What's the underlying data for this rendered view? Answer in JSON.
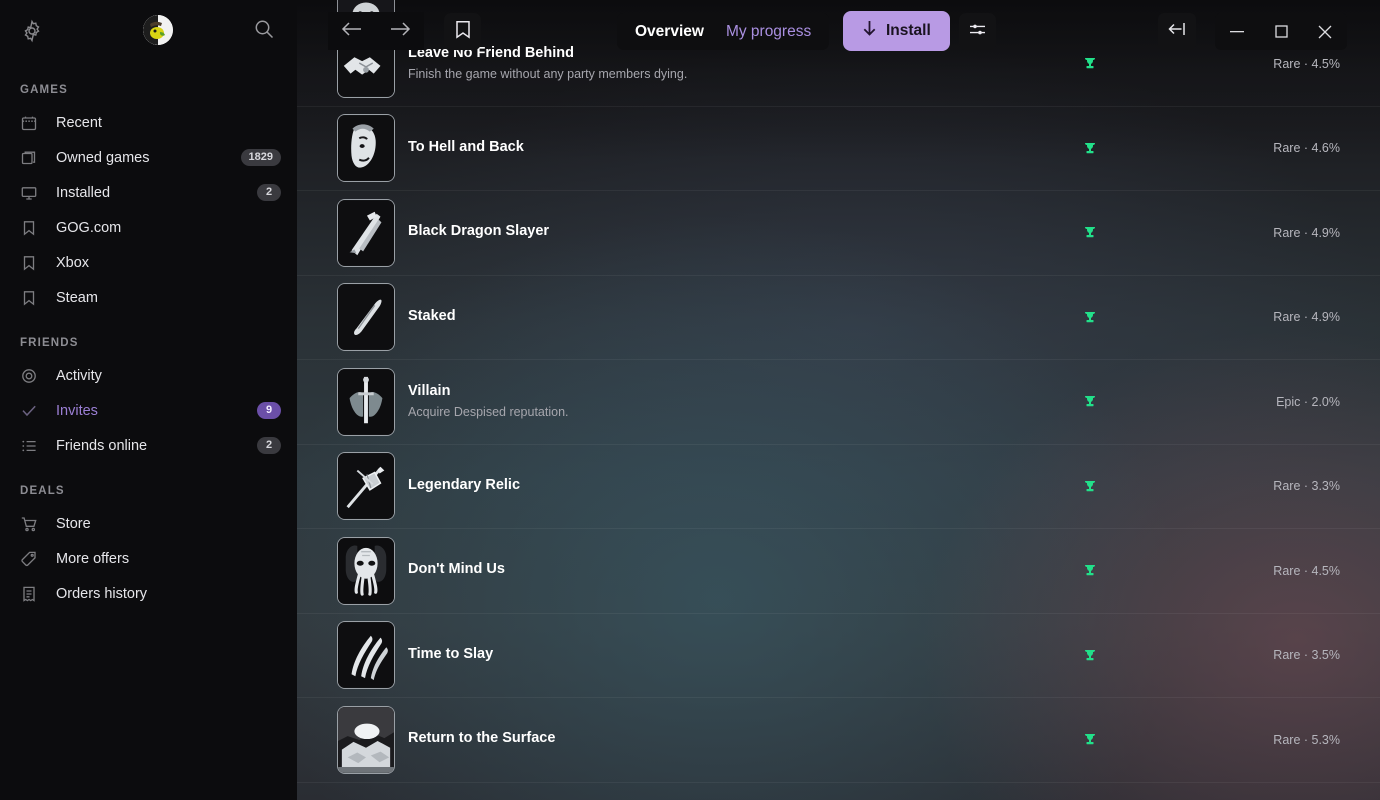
{
  "sidebar": {
    "top": {
      "settings_icon": "gear-icon",
      "avatar_icon": "user-avatar",
      "search_icon": "search-icon"
    },
    "sections": [
      {
        "title": "GAMES",
        "items": [
          {
            "label": "Recent",
            "icon": "calendar-icon",
            "badge": null,
            "accent": false
          },
          {
            "label": "Owned games",
            "icon": "stack-icon",
            "badge": "1829",
            "accent": false
          },
          {
            "label": "Installed",
            "icon": "monitor-icon",
            "badge": "2",
            "accent": false
          },
          {
            "label": "GOG.com",
            "icon": "bookmark-icon",
            "badge": null,
            "accent": false
          },
          {
            "label": "Xbox",
            "icon": "bookmark-icon",
            "badge": null,
            "accent": false
          },
          {
            "label": "Steam",
            "icon": "bookmark-icon",
            "badge": null,
            "accent": false
          }
        ]
      },
      {
        "title": "FRIENDS",
        "items": [
          {
            "label": "Activity",
            "icon": "target-icon",
            "badge": null,
            "accent": false
          },
          {
            "label": "Invites",
            "icon": "check-icon",
            "badge": "9",
            "accent": true,
            "badge_purple": true
          },
          {
            "label": "Friends online",
            "icon": "list-icon",
            "badge": "2",
            "accent": false
          }
        ]
      },
      {
        "title": "DEALS",
        "items": [
          {
            "label": "Store",
            "icon": "cart-icon",
            "badge": null,
            "accent": false
          },
          {
            "label": "More offers",
            "icon": "tag-icon",
            "badge": null,
            "accent": false
          },
          {
            "label": "Orders history",
            "icon": "receipt-icon",
            "badge": null,
            "accent": false
          }
        ]
      }
    ]
  },
  "toolbar": {
    "back_icon": "arrow-left-icon",
    "forward_icon": "arrow-right-icon",
    "bookmark_icon": "bookmark-icon",
    "tabs": [
      {
        "label": "Overview",
        "active": true
      },
      {
        "label": "My progress",
        "active": false
      }
    ],
    "install_label": "Install",
    "install_icon": "download-arrow-icon",
    "install_color": "#b89ae4",
    "filter_icon": "sliders-icon",
    "collapse_icon": "collapse-panel-icon",
    "minimize_icon": "minimize-icon",
    "maximize_icon": "maximize-icon",
    "close_icon": "close-icon"
  },
  "achievements": {
    "trophy_color": "#22e08a",
    "items": [
      {
        "name": "Leave No Friend Behind",
        "desc": "Finish the game without any party members dying.",
        "rarity": "Rare · 4.5%",
        "icon": "handshake-icon"
      },
      {
        "name": "To Hell and Back",
        "desc": "",
        "rarity": "Rare · 4.6%",
        "icon": "face-icon"
      },
      {
        "name": "Black Dragon Slayer",
        "desc": "",
        "rarity": "Rare · 4.9%",
        "icon": "dragon-claw-icon"
      },
      {
        "name": "Staked",
        "desc": "",
        "rarity": "Rare · 4.9%",
        "icon": "stake-icon"
      },
      {
        "name": "Villain",
        "desc": "Acquire Despised reputation.",
        "rarity": "Epic · 2.0%",
        "icon": "sword-icon"
      },
      {
        "name": "Legendary Relic",
        "desc": "",
        "rarity": "Rare · 3.3%",
        "icon": "relic-icon"
      },
      {
        "name": "Don't Mind Us",
        "desc": "",
        "rarity": "Rare · 4.5%",
        "icon": "mindflayer-icon"
      },
      {
        "name": "Time to Slay",
        "desc": "",
        "rarity": "Rare · 3.5%",
        "icon": "claw-marks-icon"
      },
      {
        "name": "Return to the Surface",
        "desc": "",
        "rarity": "Rare · 5.3%",
        "icon": "cave-icon"
      }
    ]
  }
}
